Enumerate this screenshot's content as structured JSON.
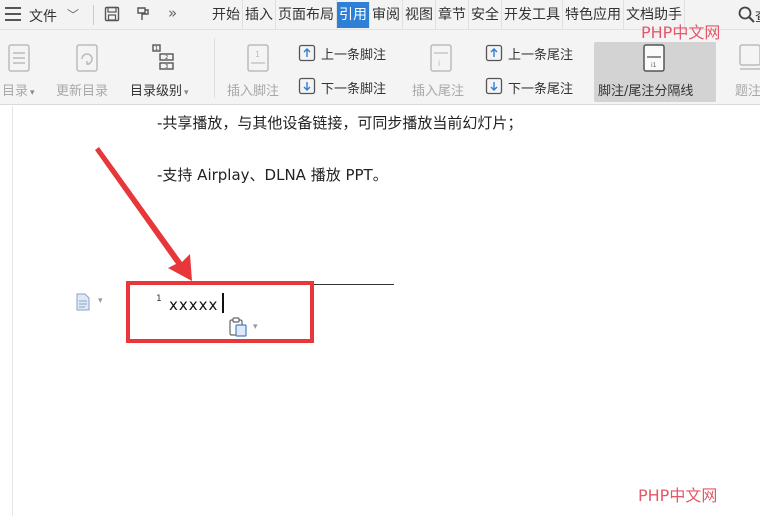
{
  "menubar": {
    "file_label": "文件",
    "tabs": [
      "开始",
      "插入",
      "页面布局",
      "引用",
      "审阅",
      "视图",
      "章节",
      "安全",
      "开发工具",
      "特色应用",
      "文档助手"
    ],
    "active_tab": "引用",
    "search_tail": "查"
  },
  "ribbon": {
    "toc": "目录",
    "update_toc": "更新目录",
    "toc_level": "目录级别",
    "insert_footnote": "插入脚注",
    "prev_footnote": "上一条脚注",
    "next_footnote": "下一条脚注",
    "insert_endnote": "插入尾注",
    "prev_endnote": "上一条尾注",
    "next_endnote": "下一条尾注",
    "separator": "脚注/尾注分隔线",
    "caption": "题注"
  },
  "document": {
    "line1": "-共享播放，与其他设备链接，可同步播放当前幻灯片；",
    "line2": "-支持 Airplay、DLNA 播放 PPT。",
    "footnote_number": "1",
    "footnote_text": "xxxxx"
  },
  "watermark": "PHP中文网",
  "colors": {
    "active_tab": "#2e7fd6",
    "highlight_box": "#e8373a",
    "watermark": "#e4576a"
  }
}
